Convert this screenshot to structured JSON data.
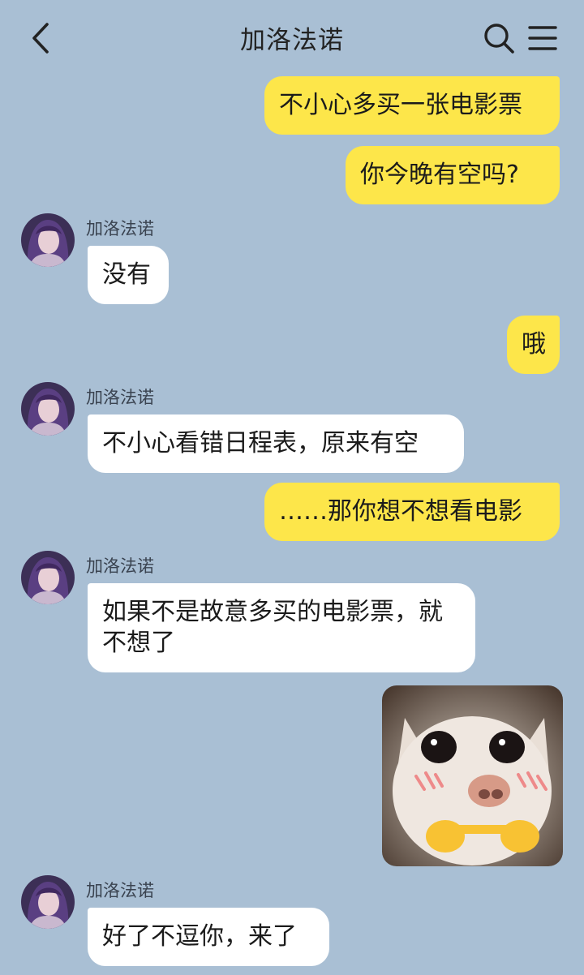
{
  "header": {
    "title": "加洛法诺",
    "back_icon": "chevron-left-icon",
    "search_icon": "search-icon",
    "menu_icon": "menu-icon"
  },
  "colors": {
    "background": "#a9bfd4",
    "outgoing_bubble": "#fde64a",
    "incoming_bubble": "#ffffff"
  },
  "messages": [
    {
      "from": "me",
      "text": "不小心多买一张电影票"
    },
    {
      "from": "me",
      "text": "你今晚有空吗?"
    },
    {
      "from": "contact",
      "sender": "加洛法诺",
      "text": "没有"
    },
    {
      "from": "me",
      "text": "哦"
    },
    {
      "from": "contact",
      "sender": "加洛法诺",
      "text": "不小心看错日程表，原来有空"
    },
    {
      "from": "me",
      "text": "……那你想不想看电影"
    },
    {
      "from": "contact",
      "sender": "加洛法诺",
      "text": "如果不是故意多买的电影票，就不想了"
    },
    {
      "from": "me",
      "type": "sticker",
      "sticker": "cat-pointing-fingers-sticker"
    },
    {
      "from": "contact",
      "sender": "加洛法诺",
      "text": "好了不逗你，来了"
    }
  ]
}
